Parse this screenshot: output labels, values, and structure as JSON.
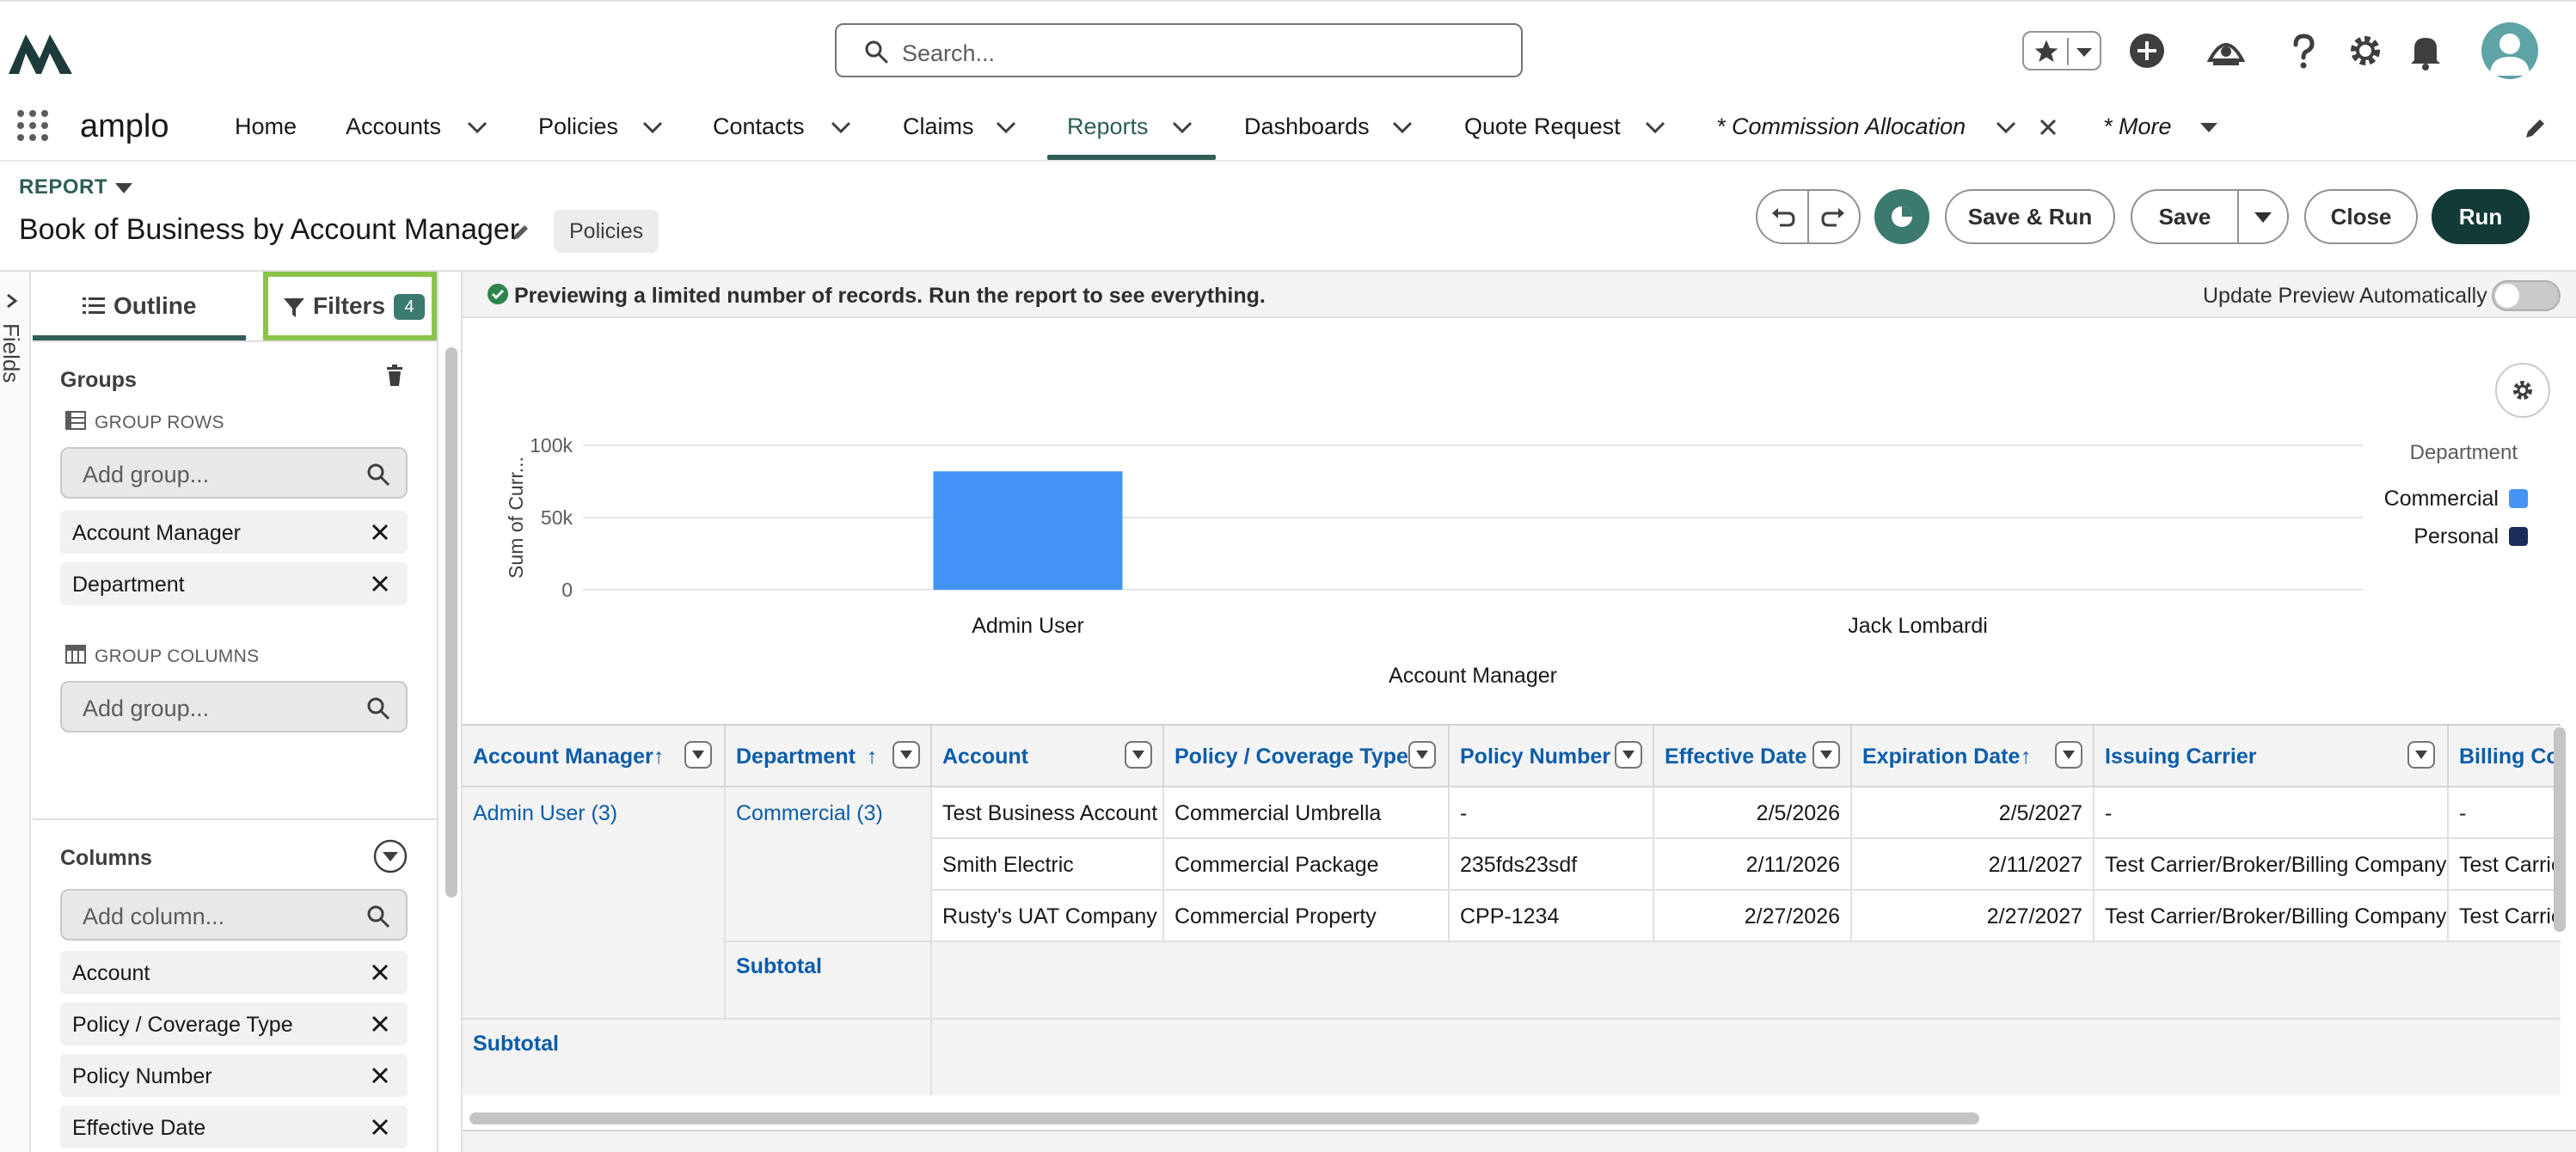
{
  "app": {
    "name": "amplo"
  },
  "search": {
    "placeholder": "Search..."
  },
  "nav": {
    "items": [
      {
        "label": "Home",
        "has_menu": false
      },
      {
        "label": "Accounts",
        "has_menu": true
      },
      {
        "label": "Policies",
        "has_menu": true
      },
      {
        "label": "Contacts",
        "has_menu": true
      },
      {
        "label": "Claims",
        "has_menu": true
      },
      {
        "label": "Reports",
        "has_menu": true,
        "active": true
      },
      {
        "label": "Dashboards",
        "has_menu": true
      },
      {
        "label": "Quote Request",
        "has_menu": true
      },
      {
        "label": "* Commission Allocation",
        "has_menu": true,
        "closable": true
      },
      {
        "label": "* More",
        "has_menu": true
      }
    ]
  },
  "report": {
    "label": "REPORT",
    "title": "Book of Business by Account Manager",
    "type_tag": "Policies"
  },
  "toolbar": {
    "save_run": "Save & Run",
    "save": "Save",
    "close": "Close",
    "run": "Run"
  },
  "left_panel": {
    "fields_tab": "Fields",
    "tabs": {
      "outline": "Outline",
      "filters": "Filters",
      "filters_count": "4"
    },
    "groups": {
      "title": "Groups",
      "group_rows_label": "GROUP ROWS",
      "group_rows_placeholder": "Add group...",
      "group_rows": [
        "Account Manager",
        "Department"
      ],
      "group_columns_label": "GROUP COLUMNS",
      "group_columns_placeholder": "Add group..."
    },
    "columns": {
      "title": "Columns",
      "placeholder": "Add column...",
      "items": [
        "Account",
        "Policy / Coverage Type",
        "Policy Number",
        "Effective Date"
      ]
    }
  },
  "preview": {
    "message": "Previewing a limited number of records. Run the report to see everything.",
    "auto_update_label": "Update Preview Automatically"
  },
  "chart_data": {
    "type": "bar",
    "categories": [
      "Admin User",
      "Jack Lombardi"
    ],
    "series": [
      {
        "name": "Commercial",
        "values": [
          82000,
          0
        ],
        "color": "#4394f5"
      },
      {
        "name": "Personal",
        "values": [
          0,
          0
        ],
        "color": "#1d2b59"
      }
    ],
    "xlabel": "Account Manager",
    "ylabel": "Sum of Curr...",
    "yticks": [
      "0",
      "50k",
      "100k"
    ],
    "ytick_values": [
      0,
      50000,
      100000
    ],
    "ylim": [
      0,
      100000
    ],
    "legend_title": "Department",
    "legend_position": "right",
    "grid": true
  },
  "table": {
    "columns": [
      {
        "label": "Account Manager",
        "sort": "↑",
        "menu": true
      },
      {
        "label": "Department",
        "sort": "↑",
        "menu": true
      },
      {
        "label": "Account",
        "sort": "",
        "menu": true
      },
      {
        "label": "Policy / Coverage Type",
        "sort": "",
        "menu": true
      },
      {
        "label": "Policy Number",
        "sort": "",
        "menu": true
      },
      {
        "label": "Effective Date",
        "sort": "",
        "menu": true
      },
      {
        "label": "Expiration Date",
        "sort": "↑",
        "menu": true
      },
      {
        "label": "Issuing Carrier",
        "sort": "",
        "menu": true
      },
      {
        "label": "Billing Co",
        "sort": "",
        "menu": false
      }
    ],
    "group_manager": "Admin User (3)",
    "group_department": "Commercial (3)",
    "rows": [
      {
        "account": "Test Business Account",
        "type": "Commercial Umbrella",
        "policy_number": "-",
        "effective": "2/5/2026",
        "expiration": "2/5/2027",
        "carrier": "-",
        "billing": "-"
      },
      {
        "account": "Smith Electric",
        "type": "Commercial Package",
        "policy_number": "235fds23sdf",
        "effective": "2/11/2026",
        "expiration": "2/11/2027",
        "carrier": "Test Carrier/Broker/Billing Company",
        "billing": "Test Carrie"
      },
      {
        "account": "Rusty's UAT Company",
        "type": "Commercial Property",
        "policy_number": "CPP-1234",
        "effective": "2/27/2026",
        "expiration": "2/27/2027",
        "carrier": "Test Carrier/Broker/Billing Company",
        "billing": "Test Carrie"
      }
    ],
    "subtotal_label": "Subtotal"
  }
}
